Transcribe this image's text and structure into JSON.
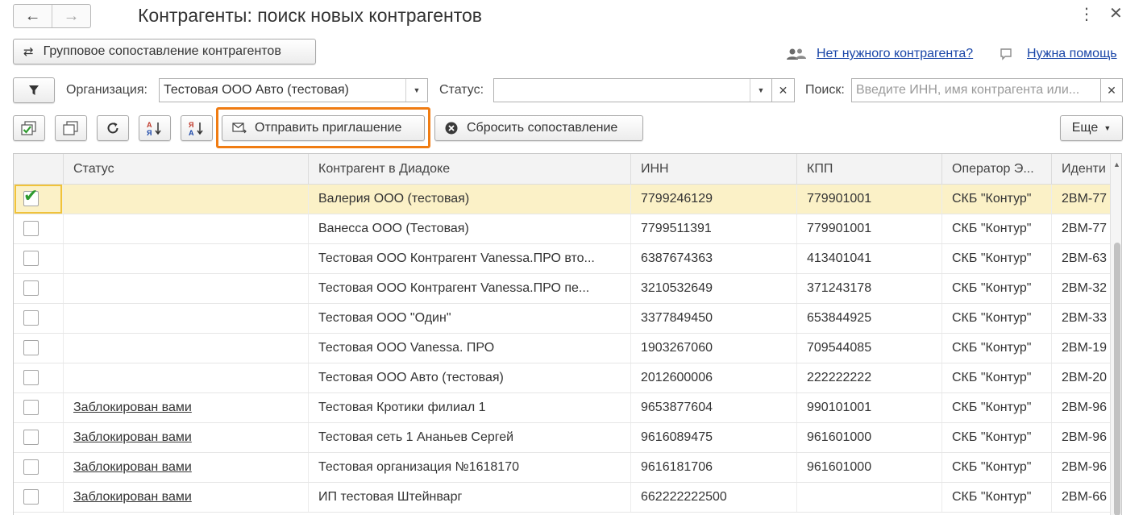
{
  "window": {
    "title": "Контрагенты: поиск новых контрагентов",
    "back_icon": "←",
    "forward_icon": "→",
    "more_icon": "⋮",
    "close_icon": "✕"
  },
  "header": {
    "group_button_label": "Групповое сопоставление контрагентов",
    "no_contractor_link": "Нет нужного контрагента?",
    "help_link": "Нужна помощь"
  },
  "filters": {
    "org_label": "Организация:",
    "org_value": "Тестовая ООО Авто (тестовая)",
    "status_label": "Статус:",
    "status_value": "",
    "search_label": "Поиск:",
    "search_placeholder": "Введите ИНН, имя контрагента или..."
  },
  "toolbar": {
    "send_invitation_label": "Отправить приглашение",
    "reset_mapping_label": "Сбросить сопоставление",
    "more_label": "Еще",
    "highlight_color": "#f07c12"
  },
  "table": {
    "columns": [
      "Статус",
      "Контрагент в Диадоке",
      "ИНН",
      "КПП",
      "Оператор Э...",
      "Иденти"
    ],
    "rows": [
      {
        "checked": true,
        "status": "",
        "name": "Валерия ООО (тестовая)",
        "inn": "7799246129",
        "kpp": "779901001",
        "operator": "СКБ \"Контур\"",
        "id": "2BM-77"
      },
      {
        "checked": false,
        "status": "",
        "name": "Ванесса ООО (Тестовая)",
        "inn": "7799511391",
        "kpp": "779901001",
        "operator": "СКБ \"Контур\"",
        "id": "2BM-77"
      },
      {
        "checked": false,
        "status": "",
        "name": "Тестовая ООО Контрагент Vanessa.ПРО вто...",
        "inn": "6387674363",
        "kpp": "413401041",
        "operator": "СКБ \"Контур\"",
        "id": "2BM-63"
      },
      {
        "checked": false,
        "status": "",
        "name": "Тестовая ООО Контрагент Vanessa.ПРО пе...",
        "inn": "3210532649",
        "kpp": "371243178",
        "operator": "СКБ \"Контур\"",
        "id": "2BM-32"
      },
      {
        "checked": false,
        "status": "",
        "name": "Тестовая ООО \"Один\"",
        "inn": "3377849450",
        "kpp": "653844925",
        "operator": "СКБ \"Контур\"",
        "id": "2BM-33"
      },
      {
        "checked": false,
        "status": "",
        "name": "Тестовая ООО Vanessa. ПРО",
        "inn": "1903267060",
        "kpp": "709544085",
        "operator": "СКБ \"Контур\"",
        "id": "2BM-19"
      },
      {
        "checked": false,
        "status": "",
        "name": "Тестовая ООО Авто (тестовая)",
        "inn": "2012600006",
        "kpp": "222222222",
        "operator": "СКБ \"Контур\"",
        "id": "2BM-20"
      },
      {
        "checked": false,
        "status": "Заблокирован вами",
        "name": "Тестовая Кротики филиал 1",
        "inn": "9653877604",
        "kpp": "990101001",
        "operator": "СКБ \"Контур\"",
        "id": "2BM-96"
      },
      {
        "checked": false,
        "status": "Заблокирован вами",
        "name": "Тестовая сеть 1 Ананьев Сергей",
        "inn": "9616089475",
        "kpp": "961601000",
        "operator": "СКБ \"Контур\"",
        "id": "2BM-96"
      },
      {
        "checked": false,
        "status": "Заблокирован вами",
        "name": "Тестовая организация №1618170",
        "inn": "9616181706",
        "kpp": "961601000",
        "operator": "СКБ \"Контур\"",
        "id": "2BM-96"
      },
      {
        "checked": false,
        "status": "Заблокирован вами",
        "name": "ИП тестовая Штейнварг",
        "inn": "662222222500",
        "kpp": "",
        "operator": "СКБ \"Контур\"",
        "id": "2BM-66"
      }
    ]
  }
}
